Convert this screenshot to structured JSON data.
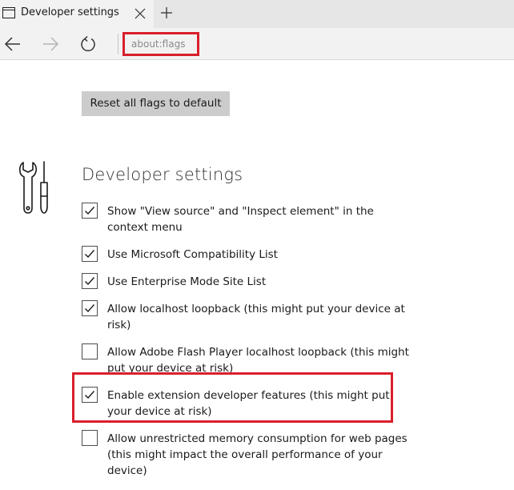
{
  "tab": {
    "title": "Developer settings"
  },
  "address_bar": {
    "url": "about:flags"
  },
  "content": {
    "reset_button_label": "Reset all flags to default",
    "section_title": "Developer settings",
    "options": [
      {
        "label": "Show \"View source\" and \"Inspect element\" in the context menu",
        "checked": true
      },
      {
        "label": "Use Microsoft Compatibility List",
        "checked": true
      },
      {
        "label": "Use Enterprise Mode Site List",
        "checked": true
      },
      {
        "label": "Allow localhost loopback (this might put your device at risk)",
        "checked": true
      },
      {
        "label": "Allow Adobe Flash Player localhost loopback (this might put your device at risk)",
        "checked": false
      },
      {
        "label": "Enable extension developer features (this might put your device at risk)",
        "checked": true
      },
      {
        "label": "Allow unrestricted memory consumption for web pages (this might impact the overall performance of your device)",
        "checked": false
      }
    ]
  },
  "colors": {
    "highlight": "#d9202b",
    "tab_active": "#f2f2f2",
    "tabstrip": "#e6e6e6",
    "button_bg": "#cccccc"
  }
}
